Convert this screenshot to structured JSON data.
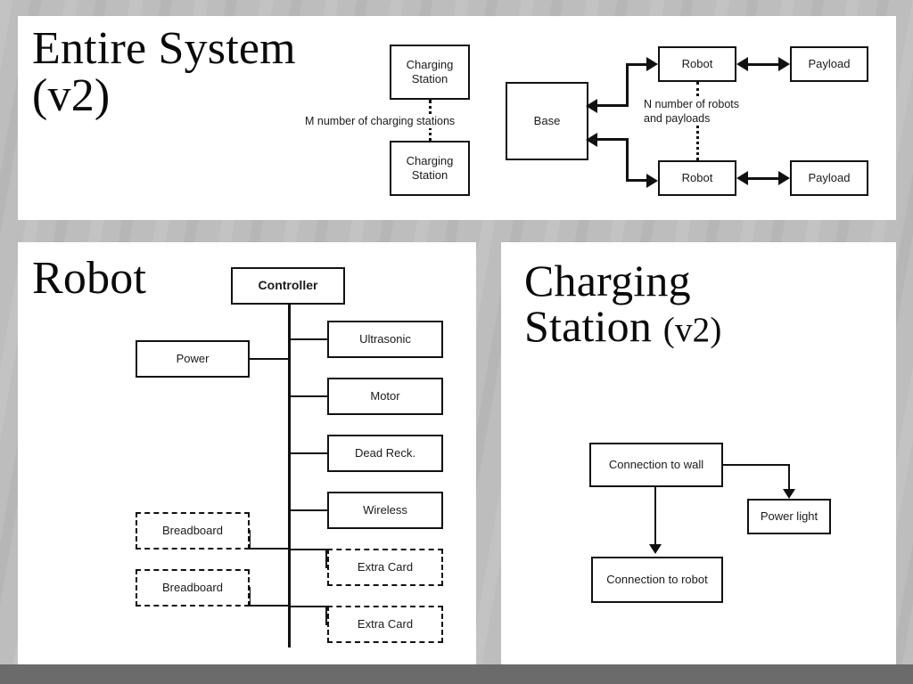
{
  "slide": {
    "background_color": "#bdbdbd",
    "panel_color": "#ffffff",
    "bottom_band_color": "#6b6b6b",
    "line_color": "#111111"
  },
  "panels": {
    "system": {
      "title_line1": "Entire System",
      "title_line2": "(v2)",
      "boxes": {
        "charging_station_top": "Charging\nStation",
        "charging_station_bottom": "Charging\nStation",
        "base": "Base",
        "robot_top": "Robot",
        "robot_bottom": "Robot",
        "payload_top": "Payload",
        "payload_bottom": "Payload"
      },
      "notes": {
        "charging_count": "M number of charging stations",
        "robot_count": "N number of robots\nand payloads"
      }
    },
    "robot": {
      "title": "Robot",
      "boxes": {
        "controller": "Controller",
        "power": "Power",
        "ultrasonic": "Ultrasonic",
        "motor": "Motor",
        "dead_reckoning": "Dead Reck.",
        "wireless": "Wireless",
        "breadboard_1": "Breadboard",
        "breadboard_2": "Breadboard",
        "extra_card_1": "Extra Card",
        "extra_card_2": "Extra Card"
      }
    },
    "charging": {
      "title_line1": "Charging",
      "title_line2": "Station",
      "title_suffix": "(v2)",
      "boxes": {
        "connection_to_wall": "Connection to wall",
        "power_light": "Power light",
        "connection_to_robot": "Connection to robot"
      }
    }
  }
}
